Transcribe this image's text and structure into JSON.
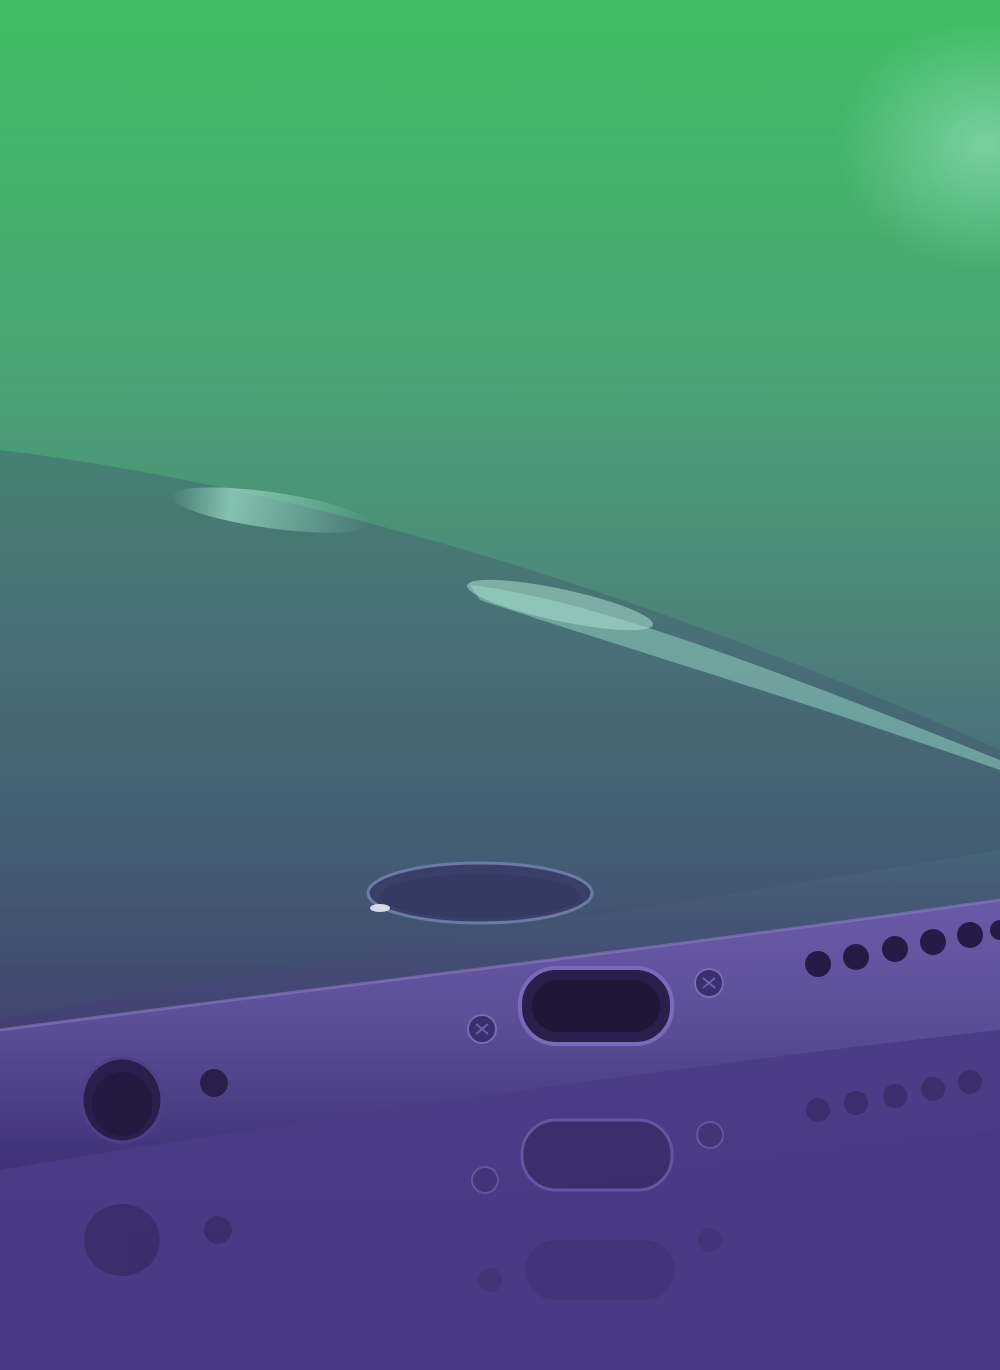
{
  "image": {
    "subject": "phone-bottom-edge-closeup",
    "overlay": "green-to-purple-duotone",
    "colors": {
      "top": "#3fbe63",
      "middle": "#4d7f7b",
      "lower": "#42406f",
      "bottom": "#55368f",
      "highlight": "#8ad9b0",
      "metal": "#5b4f98",
      "metal_dark": "#2a1f4c"
    },
    "icons": [
      "home-button",
      "lightning-port",
      "headphone-jack",
      "speaker-grille",
      "screw"
    ]
  }
}
